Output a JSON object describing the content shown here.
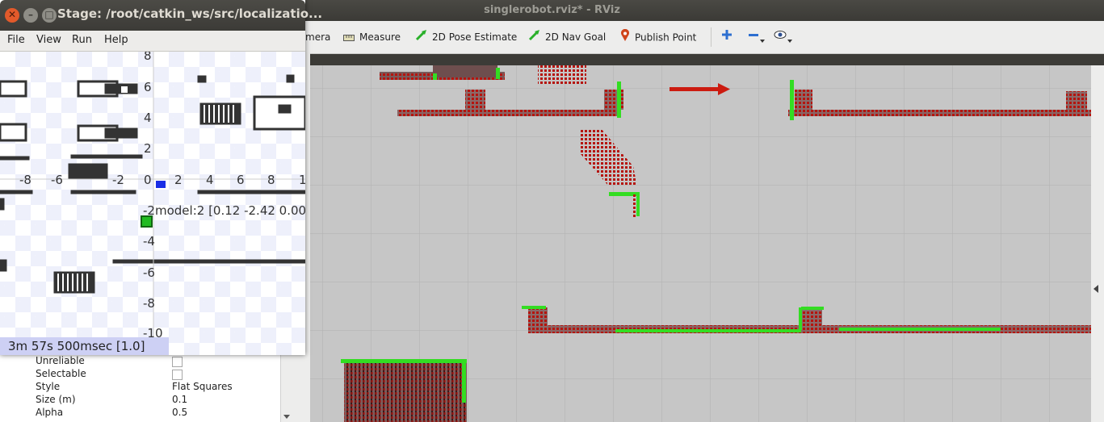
{
  "rviz": {
    "title": "singlerobot.rviz* - RViz",
    "toolbar": {
      "camera_partial": "mera",
      "measure": "Measure",
      "pose_estimate": "2D Pose Estimate",
      "nav_goal": "2D Nav Goal",
      "publish_point": "Publish Point"
    },
    "properties": [
      {
        "key": "Unreliable",
        "type": "checkbox",
        "value": ""
      },
      {
        "key": "Selectable",
        "type": "checkbox",
        "value": ""
      },
      {
        "key": "Style",
        "type": "text",
        "value": "Flat Squares"
      },
      {
        "key": "Size (m)",
        "type": "text",
        "value": "0.1"
      },
      {
        "key": "Alpha",
        "type": "text",
        "value": "0.5"
      }
    ]
  },
  "stage": {
    "title": "Stage: /root/catkin_ws/src/localizatio...",
    "menu": [
      "File",
      "View",
      "Run",
      "Help"
    ],
    "model_label": "model:2 [0.12 -2.42 0.00 1",
    "status": "3m 57s 500msec [1.0]",
    "y_ticks": [
      "8",
      "6",
      "4",
      "2",
      "-2",
      "-4",
      "-6",
      "-8",
      "-10"
    ],
    "x_ticks": [
      "-8",
      "-6",
      "-2",
      "0",
      "2",
      "4",
      "6",
      "8",
      "1"
    ]
  },
  "colors": {
    "laser": "#33dd22",
    "particles": "#b5140e",
    "arrow": "#cc1b10",
    "robot": "#1a2ee6",
    "model": "#22bb22"
  }
}
